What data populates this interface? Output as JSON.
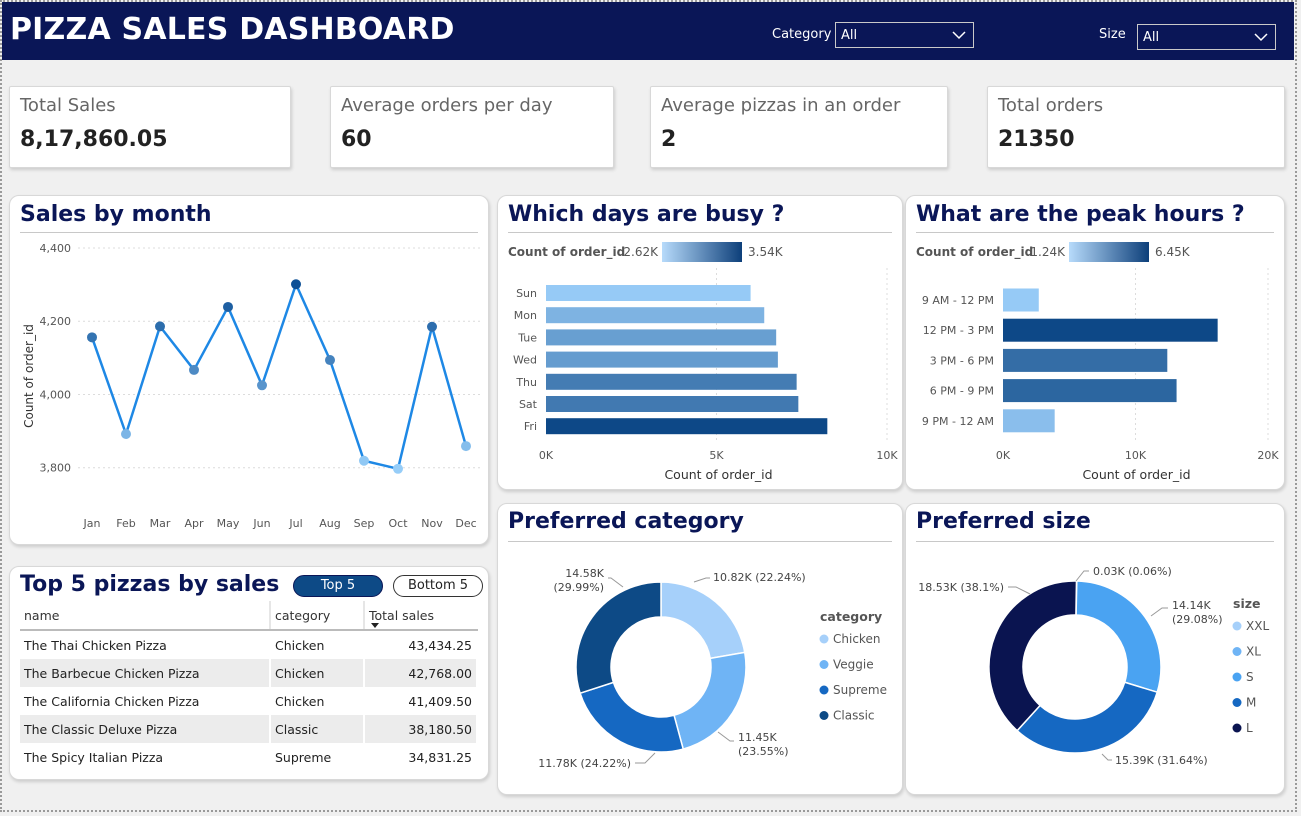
{
  "header": {
    "title": "PIZZA SALES DASHBOARD",
    "filters": [
      {
        "label": "Category",
        "value": "All",
        "icon": "chevron-down-icon"
      },
      {
        "label": "Size",
        "value": "All",
        "icon": "chevron-down-icon"
      }
    ]
  },
  "kpis": [
    {
      "label": "Total Sales",
      "value": "8,17,860.05"
    },
    {
      "label": "Average orders per day",
      "value": "60"
    },
    {
      "label": "Average pizzas in an order",
      "value": "2"
    },
    {
      "label": "Total orders",
      "value": "21350"
    }
  ],
  "sales_by_month": {
    "title": "Sales by month"
  },
  "busy_days": {
    "title": "Which days are busy ?",
    "legend_label": "Count of order_id",
    "legend_min": "2.62K",
    "legend_max": "3.54K"
  },
  "peak_hours": {
    "title": "What are the peak hours ?",
    "legend_label": "Count of order_id",
    "legend_min": "1.24K",
    "legend_max": "6.45K"
  },
  "preferred_category": {
    "title": "Preferred category",
    "legend_title": "category"
  },
  "preferred_size": {
    "title": "Preferred size",
    "legend_title": "size"
  },
  "top_pizzas": {
    "title": "Top 5 pizzas by sales",
    "buttons": {
      "top": "Top 5",
      "bottom": "Bottom 5"
    },
    "columns": [
      "name",
      "category",
      "Total sales"
    ],
    "rows": [
      [
        "The Thai Chicken Pizza",
        "Chicken",
        "43,434.25"
      ],
      [
        "The Barbecue Chicken Pizza",
        "Chicken",
        "42,768.00"
      ],
      [
        "The California Chicken Pizza",
        "Chicken",
        "41,409.50"
      ],
      [
        "The Classic Deluxe Pizza",
        "Classic",
        "38,180.50"
      ],
      [
        "The Spicy Italian Pizza",
        "Supreme",
        "34,831.25"
      ]
    ]
  },
  "colors": {
    "header_bg": "#0a1657",
    "line": "#1e88e5",
    "dark_blue": "#0d4a86"
  },
  "chart_data": [
    {
      "type": "line",
      "title": "Sales by month",
      "xlabel": "",
      "ylabel": "Count of order_id",
      "x": [
        "Jan",
        "Feb",
        "Mar",
        "Apr",
        "May",
        "Jun",
        "Jul",
        "Aug",
        "Sep",
        "Oct",
        "Nov",
        "Dec"
      ],
      "values": [
        4156,
        3892,
        4186,
        4067,
        4239,
        4025,
        4301,
        4094,
        3819,
        3797,
        4185,
        3859
      ],
      "ylim": [
        3750,
        4400
      ],
      "yticks": [
        3800,
        4000,
        4200,
        4400
      ],
      "ytick_labels": [
        "3,800",
        "4,000",
        "4,200",
        "4,400"
      ],
      "grid": true
    },
    {
      "type": "bar",
      "orientation": "horizontal",
      "title": "Which days are busy ?",
      "categories": [
        "Sun",
        "Mon",
        "Tue",
        "Wed",
        "Thu",
        "Sat",
        "Fri"
      ],
      "values": [
        6000,
        6400,
        6750,
        6800,
        7350,
        7400,
        8250
      ],
      "xlabel": "Count of order_id",
      "xlim": [
        0,
        10000
      ],
      "xticks": [
        0,
        5000,
        10000
      ],
      "xtick_labels": [
        "0K",
        "5K",
        "10K"
      ]
    },
    {
      "type": "bar",
      "orientation": "horizontal",
      "title": "What are the peak hours ?",
      "categories": [
        "9 AM - 12 PM",
        "12 PM - 3 PM",
        "3 PM - 6 PM",
        "6 PM - 9 PM",
        "9 PM - 12 AM"
      ],
      "values": [
        2700,
        16200,
        12400,
        13100,
        3900
      ],
      "xlabel": "Count of order_id",
      "xlim": [
        0,
        20000
      ],
      "xticks": [
        0,
        10000,
        20000
      ],
      "xtick_labels": [
        "0K",
        "10K",
        "20K"
      ]
    },
    {
      "type": "pie",
      "donut": true,
      "title": "Preferred category",
      "labels": [
        "Chicken",
        "Veggie",
        "Supreme",
        "Classic"
      ],
      "values": [
        10.82,
        11.45,
        11.78,
        14.58
      ],
      "data_labels": [
        "10.82K (22.24%)",
        "11.45K (23.55%)",
        "11.78K (24.22%)",
        "14.58K (29.99%)"
      ],
      "colors": [
        "#a6d0fa",
        "#6fb4f5",
        "#1568c2",
        "#0d4a86"
      ]
    },
    {
      "type": "pie",
      "donut": true,
      "title": "Preferred size",
      "labels": [
        "XXL",
        "XL",
        "S",
        "M",
        "L"
      ],
      "values": [
        0.03,
        0,
        14.14,
        15.39,
        18.53
      ],
      "data_labels": [
        "0.03K (0.06%)",
        "",
        "14.14K (29.08%)",
        "15.39K (31.64%)",
        "18.53K (38.1%)"
      ],
      "colors": [
        "#a6d0fa",
        "#6fb4f5",
        "#4aa3f2",
        "#1568c2",
        "#0a1450"
      ]
    }
  ]
}
